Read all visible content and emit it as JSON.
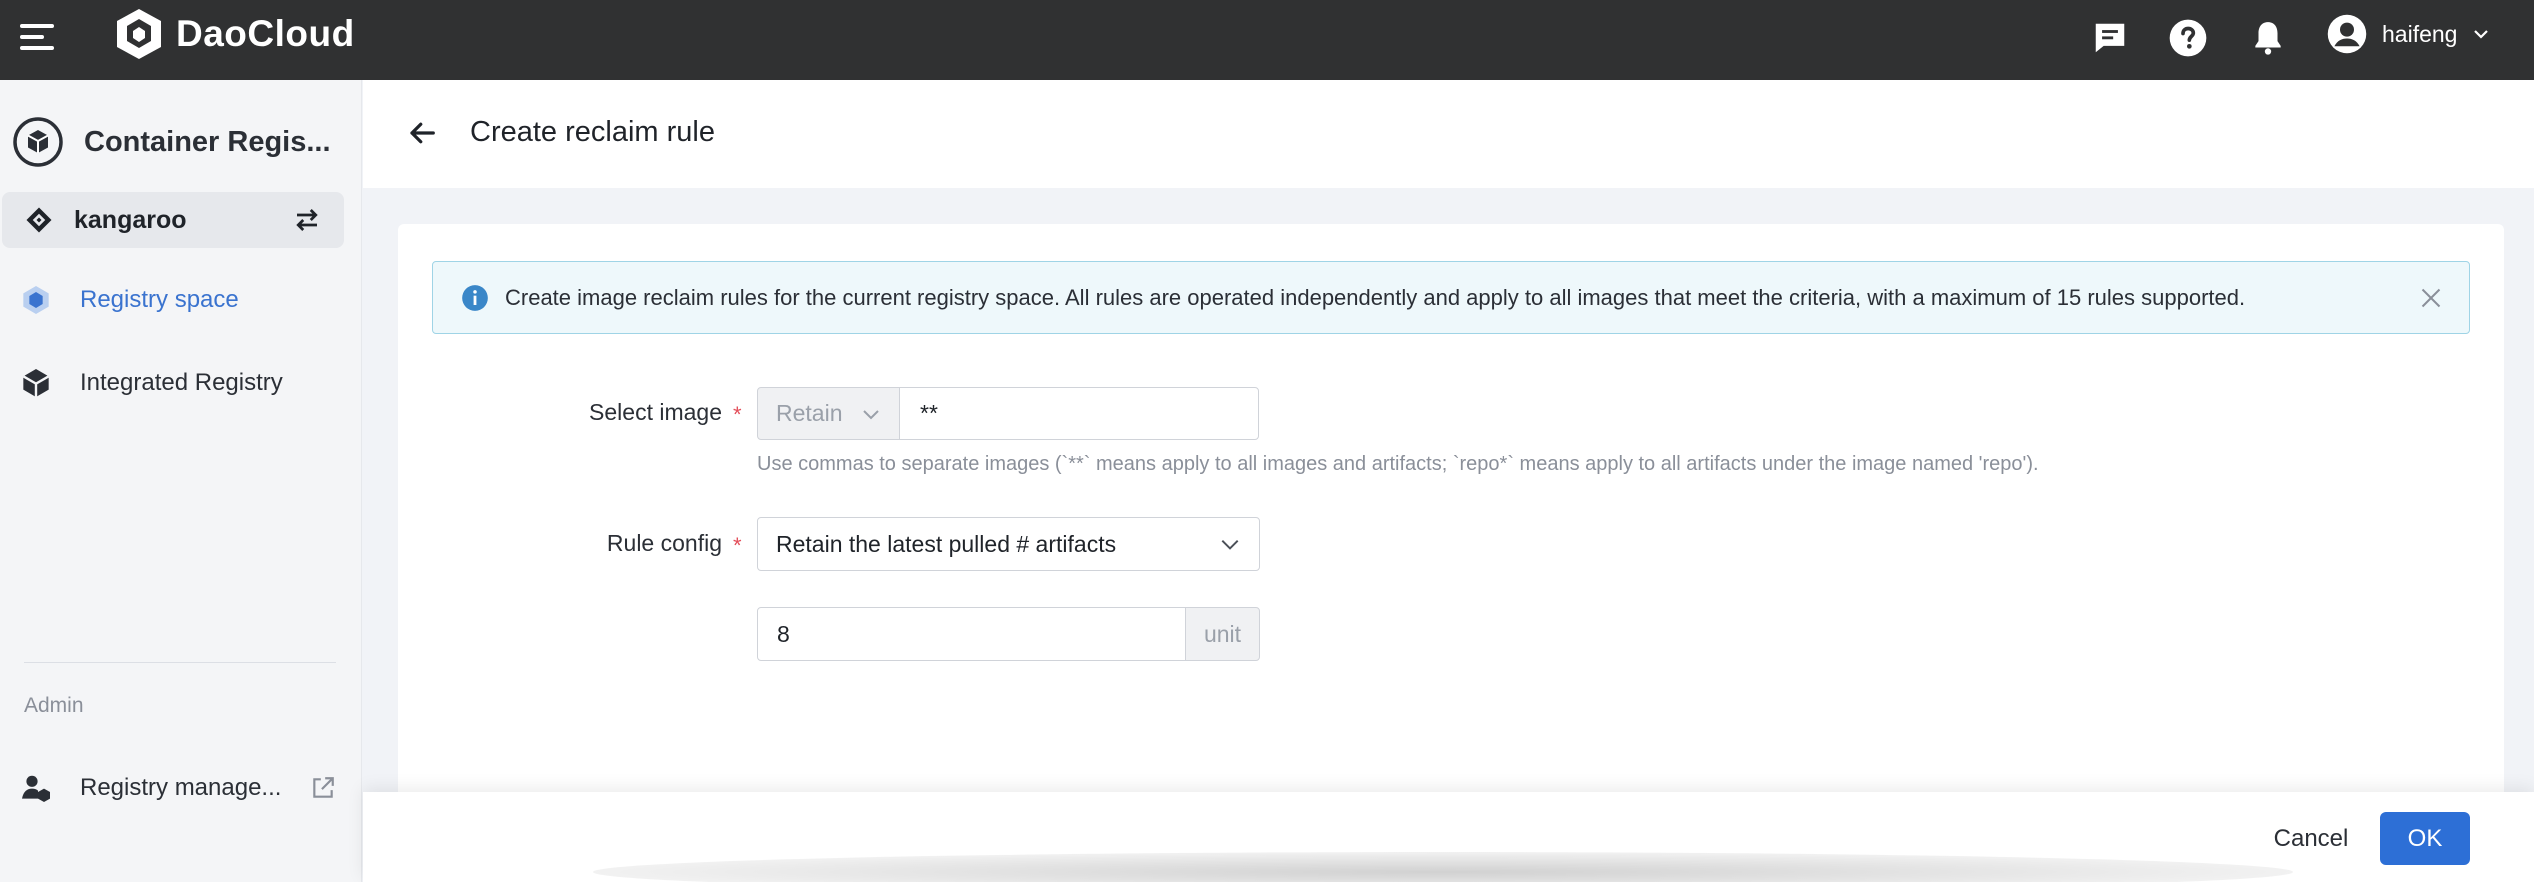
{
  "topbar": {
    "brand": "DaoCloud",
    "user_name": "haifeng"
  },
  "sidebar": {
    "module_title": "Container Regis...",
    "workspace": "kangaroo",
    "items": [
      {
        "label": "Registry space",
        "active": true
      },
      {
        "label": "Integrated Registry",
        "active": false
      }
    ],
    "admin_label": "Admin",
    "admin_items": [
      {
        "label": "Registry manage..."
      }
    ]
  },
  "header": {
    "title": "Create reclaim rule"
  },
  "alert": {
    "text": "Create image reclaim rules for the current registry space. All rules are operated independently and apply to all images that meet the criteria, with a maximum of 15 rules supported."
  },
  "form": {
    "select_image_label": "Select image",
    "select_image_mode": "Retain",
    "select_image_value": "**",
    "select_image_hint": "Use commas to separate images (`**` means apply to all images and artifacts; `repo*` means apply to all artifacts under the image named 'repo').",
    "rule_config_label": "Rule config",
    "rule_config_value": "Retain the latest pulled # artifacts",
    "count_value": "8",
    "count_unit": "unit",
    "required_mark": "*"
  },
  "footer": {
    "cancel_label": "Cancel",
    "ok_label": "OK"
  },
  "colors": {
    "primary": "#2d6fd6",
    "topbar": "#303132",
    "active_nav": "#3a73cf",
    "required": "#e34d59"
  }
}
